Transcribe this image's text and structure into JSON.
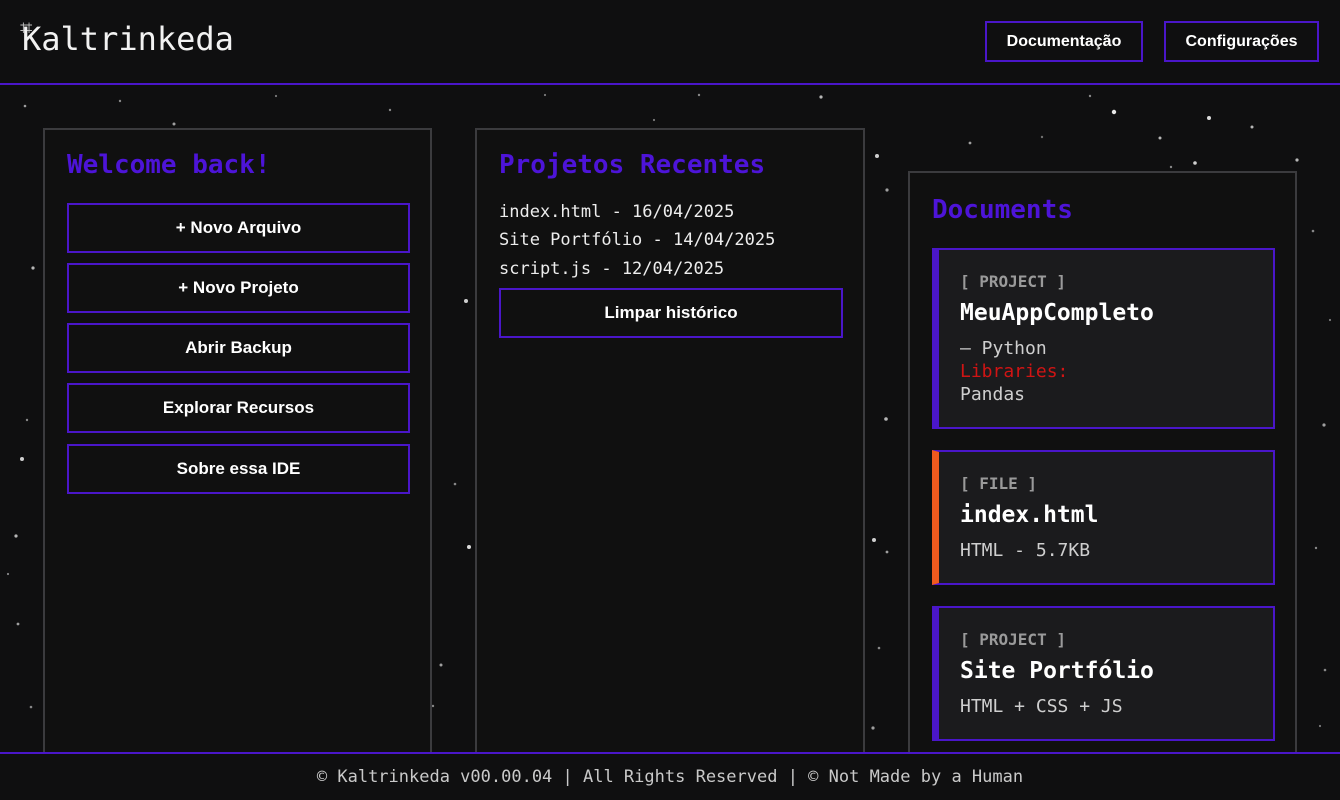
{
  "app": {
    "logo_glyph": "⌗",
    "title": "Kaltrinkeda"
  },
  "header": {
    "nav": [
      {
        "label": "Documentação"
      },
      {
        "label": "Configurações"
      }
    ]
  },
  "welcome": {
    "title": "Welcome back!",
    "actions": [
      {
        "label": "+ Novo Arquivo"
      },
      {
        "label": "+ Novo Projeto"
      },
      {
        "label": "Abrir Backup"
      },
      {
        "label": "Explorar Recursos"
      },
      {
        "label": "Sobre essa IDE"
      }
    ]
  },
  "recent": {
    "title": "Projetos Recentes",
    "items": [
      {
        "text": "index.html - 16/04/2025"
      },
      {
        "text": "Site Portfólio - 14/04/2025"
      },
      {
        "text": "script.js - 12/04/2025"
      }
    ],
    "clear_label": "Limpar histórico"
  },
  "documents": {
    "title": "Documents",
    "cards": [
      {
        "tag": "[ PROJECT ]",
        "name": "MeuAppCompleto",
        "lines": [
          "— Python"
        ],
        "libraries_label": "Libraries:",
        "libraries_value": "Pandas",
        "accent": "#4a16c9"
      },
      {
        "tag": "[ FILE ]",
        "name": "index.html",
        "lines": [
          "HTML - 5.7KB"
        ],
        "accent": "#f05a1e"
      },
      {
        "tag": "[ PROJECT ]",
        "name": "Site Portfólio",
        "lines": [
          "HTML + CSS + JS"
        ],
        "accent": "#4a16c9"
      }
    ]
  },
  "footer": {
    "text": "© Kaltrinkeda v00.00.04 | All Rights Reserved | © Not Made by a Human"
  },
  "colors": {
    "accent": "#4a16c9",
    "title": "#4d14d8",
    "libraries_label": "#d01414",
    "file_accent": "#f05a1e",
    "background": "#0f0f10"
  }
}
